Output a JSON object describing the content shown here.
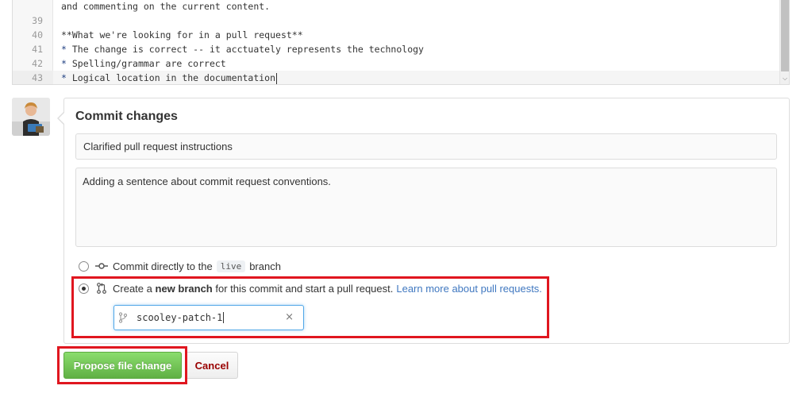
{
  "editor": {
    "lines": [
      {
        "num": "",
        "text": "and commenting on the current content.",
        "style": "plain"
      },
      {
        "num": "39",
        "text": "",
        "style": "plain"
      },
      {
        "num": "40",
        "text": "**What we're looking for in a pull request**",
        "style": "bold"
      },
      {
        "num": "41",
        "text": "* The change is correct -- it acctuately represents the technology",
        "style": "list"
      },
      {
        "num": "42",
        "text": "* Spelling/grammar are correct",
        "style": "list"
      },
      {
        "num": "43",
        "text": "* Logical location in the documentation",
        "style": "list",
        "active": true
      }
    ]
  },
  "commit": {
    "title": "Commit changes",
    "summary_value": "Clarified pull request instructions",
    "description_value": "Adding a sentence about commit request conventions.",
    "option_direct": {
      "prefix": "Commit directly to the",
      "branch": "live",
      "suffix": "branch"
    },
    "option_new_branch": {
      "prefix": "Create a",
      "bold": "new branch",
      "suffix": "for this commit and start a pull request.",
      "link": "Learn more about pull requests."
    },
    "branch_name": "scooley-patch-1",
    "selected_option": "new_branch"
  },
  "buttons": {
    "propose": "Propose file change",
    "cancel": "Cancel"
  },
  "colors": {
    "highlight": "#e0161f",
    "link": "#4078c0",
    "propose_green": "#60b044",
    "cancel_red": "#990000"
  }
}
